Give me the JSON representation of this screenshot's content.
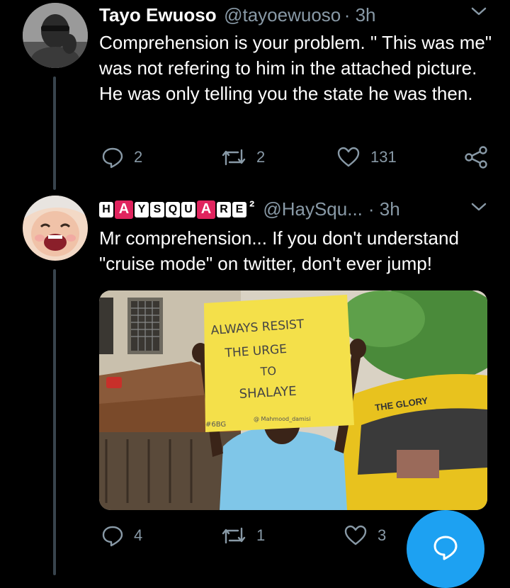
{
  "tweets": [
    {
      "name": "Tayo Ewuoso",
      "handle": "@tayoewuoso",
      "time": "· 3h",
      "text": "Comprehension is your problem. \" This was me\" was not refering to him in the attached picture. He was only telling you the state he was then.",
      "replies": "2",
      "retweets": "2",
      "likes": "131"
    },
    {
      "name_letters": [
        "H",
        "A",
        "Y",
        "S",
        "Q",
        "U",
        "A",
        "R",
        "E"
      ],
      "name_superscript": "²",
      "handle": "@HaySqu...",
      "time": "· 3h",
      "text": "Mr comprehension... If you don't understand \"cruise mode\" on twitter,  don't ever jump!",
      "replies": "4",
      "retweets": "1",
      "likes": "3",
      "media": {
        "sign_lines": [
          "ALWAYS RESIST",
          "THE URGE",
          "TO",
          "SHALAYE"
        ],
        "sign_hashtag": "#6BG",
        "sign_credit": "@ Mahmood_damisi",
        "bus_text": "THE GLORY"
      }
    }
  ],
  "icons": [
    "chevron-down-icon",
    "reply-icon",
    "retweet-icon",
    "like-icon",
    "share-icon",
    "compose-icon"
  ],
  "colors": {
    "background": "#000000",
    "muted": "#8899a6",
    "accent": "#1da1f2",
    "thread_line": "#38444d"
  }
}
